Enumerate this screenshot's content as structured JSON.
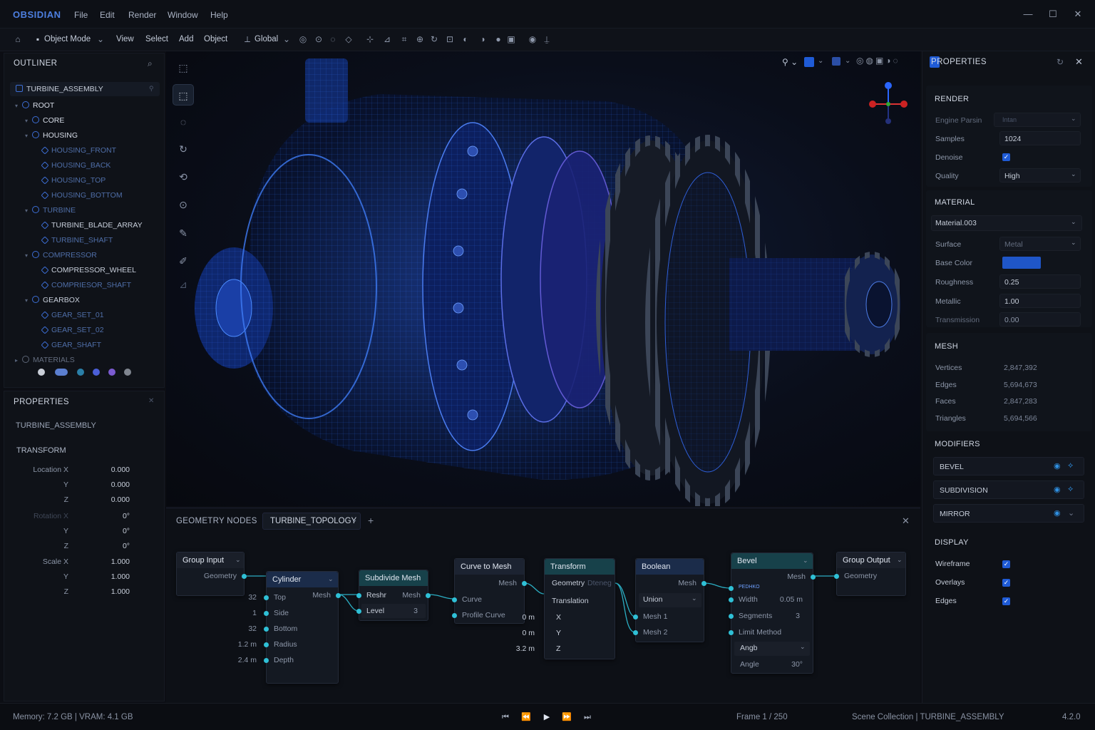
{
  "app": {
    "name": "OBSIDIAN",
    "menu": [
      "File",
      "Edit",
      "Render",
      "Window",
      "Help"
    ]
  },
  "toolbar": {
    "mode": "Object Mode",
    "items": [
      "View",
      "Select",
      "Add",
      "Object"
    ],
    "transform": "Global"
  },
  "outliner": {
    "title": "OUTLINER",
    "root_item": "TURBINE_ASSEMBLY",
    "nodes": [
      {
        "label": "ROOT",
        "depth": 0,
        "tone": "bright"
      },
      {
        "label": "CORE",
        "depth": 1,
        "tone": "bright"
      },
      {
        "label": "HOUSING",
        "depth": 1,
        "tone": "bright"
      },
      {
        "label": "HOUSING_FRONT",
        "depth": 2,
        "tone": "dim"
      },
      {
        "label": "HOUSING_BACK",
        "depth": 2,
        "tone": "dim"
      },
      {
        "label": "HOUSING_TOP",
        "depth": 2,
        "tone": "dim"
      },
      {
        "label": "HOUSING_BOTTOM",
        "depth": 2,
        "tone": "dim"
      },
      {
        "label": "TURBINE",
        "depth": 1,
        "tone": "dim"
      },
      {
        "label": "TURBINE_BLADE_ARRAY",
        "depth": 2,
        "tone": "mid"
      },
      {
        "label": "TURBINE_SHAFT",
        "depth": 2,
        "tone": "dim"
      },
      {
        "label": "COMPRESSOR",
        "depth": 1,
        "tone": "dim"
      },
      {
        "label": "COMPRESSOR_WHEEL",
        "depth": 2,
        "tone": "mid"
      },
      {
        "label": "COMPRIESOR_SHAFT",
        "depth": 2,
        "tone": "dim"
      },
      {
        "label": "GEARBOX",
        "depth": 1,
        "tone": "mid"
      },
      {
        "label": "GEAR_SET_01",
        "depth": 2,
        "tone": "dim"
      },
      {
        "label": "GEAR_SET_02",
        "depth": 2,
        "tone": "dim"
      },
      {
        "label": "GEAR_SHAFT",
        "depth": 2,
        "tone": "dim"
      },
      {
        "label": "MATERIALS",
        "depth": 0,
        "tone": "grey"
      }
    ],
    "material_swatches": [
      "#c9ced8",
      "#5b7fd0",
      "#2a7fa8",
      "#4b5fd8",
      "#7b5bd0",
      "#808690"
    ]
  },
  "left_properties": {
    "title": "PROPERTIES",
    "object": "TURBINE_ASSEMBLY",
    "transform_title": "TRANSFORM",
    "rows": [
      {
        "label": "Location X",
        "value": "0.000"
      },
      {
        "label": "Y",
        "value": "0.000"
      },
      {
        "label": "Z",
        "value": "0.000"
      },
      {
        "label": "Rotation X",
        "value": "0°"
      },
      {
        "label": "Y",
        "value": "0°"
      },
      {
        "label": "Z",
        "value": "0°"
      },
      {
        "label": "Scale X",
        "value": "1.000"
      },
      {
        "label": "Y",
        "value": "1.000"
      },
      {
        "label": "Z",
        "value": "1.000"
      }
    ]
  },
  "node_editor": {
    "title": "GEOMETRY NODES",
    "tree": "TURBINE_TOPOLOGY",
    "group_input": {
      "title": "Group Input",
      "out": "Geometry"
    },
    "cylinder": {
      "title": "Cylinder",
      "out": "Mesh",
      "rows": [
        [
          "Top",
          "32"
        ],
        [
          "Side",
          "1"
        ],
        [
          "Bottom",
          "32"
        ],
        [
          "Radius",
          "1.2 m"
        ],
        [
          "Depth",
          "2.4 m"
        ]
      ]
    },
    "subdivide": {
      "title": "Subdivide Mesh",
      "in": "Reshr",
      "out": "Mesh",
      "level_label": "Level",
      "level": "3"
    },
    "curve_to_mesh": {
      "title": "Curve to Mesh",
      "out": "Mesh",
      "in1": "Curve",
      "in2": "Profile Curve"
    },
    "transform": {
      "title": "Transform",
      "geo": "Geometry",
      "geo2": "Dteneg",
      "translation": "Translation",
      "rows": [
        [
          "X",
          "0 m"
        ],
        [
          "Y",
          "0 m"
        ],
        [
          "Z",
          "3.2 m"
        ]
      ]
    },
    "boolean": {
      "title": "Boolean",
      "out": "Mesh",
      "op": "Union",
      "in1": "Mesh 1",
      "in2": "Mesh 2"
    },
    "bevel": {
      "title": "Bevel",
      "out": "Mesh",
      "tag": "PEDHKO",
      "width_label": "Width",
      "width": "0.05 m",
      "segments_label": "Segments",
      "segments": "3",
      "limit": "Limit Method",
      "limit_val": "Angb",
      "angle_label": "Angle",
      "angle": "30°"
    },
    "group_output": {
      "title": "Group Output",
      "in": "Geometry"
    }
  },
  "right_panel": {
    "title": "PROPERTIES",
    "render": {
      "title": "RENDER",
      "engine_label": "Engine Parsin",
      "engine_value": "Intan",
      "samples_label": "Samples",
      "samples": "1024",
      "denoise_label": "Denoise",
      "quality_label": "Quality",
      "quality": "High"
    },
    "material": {
      "title": "MATERIAL",
      "name": "Material.003",
      "surface_label": "Surface",
      "surface": "Metal",
      "base_color_label": "Base Color",
      "base_color": "#1f56c8",
      "roughness_label": "Roughness",
      "roughness": "0.25",
      "metallic_label": "Metallic",
      "metallic": "1.00",
      "transmission_label": "Transmission",
      "transmission": "0.00"
    },
    "mesh": {
      "title": "MESH",
      "rows": [
        [
          "Vertices",
          "2,847,392"
        ],
        [
          "Edges",
          "5,694,673"
        ],
        [
          "Faces",
          "2,847,283"
        ],
        [
          "Triangles",
          "5,694,566"
        ]
      ]
    },
    "modifiers": {
      "title": "MODIFIERS",
      "items": [
        "BEVEL",
        "SUBDIVISION",
        "MIRROR"
      ]
    },
    "display": {
      "title": "DISPLAY",
      "items": [
        "Wireframe",
        "Overlays",
        "Edges"
      ]
    }
  },
  "status": {
    "memory": "Memory: 7.2 GB | VRAM: 4.1 GB",
    "frame": "Frame 1 / 250",
    "scene": "Scene Collection | TURBINE_ASSEMBLY",
    "version": "4.2.0"
  },
  "colors": {
    "accent": "#2fc0d6",
    "brand": "#4d7fe0",
    "mesh_blue": "#2a6dff"
  }
}
